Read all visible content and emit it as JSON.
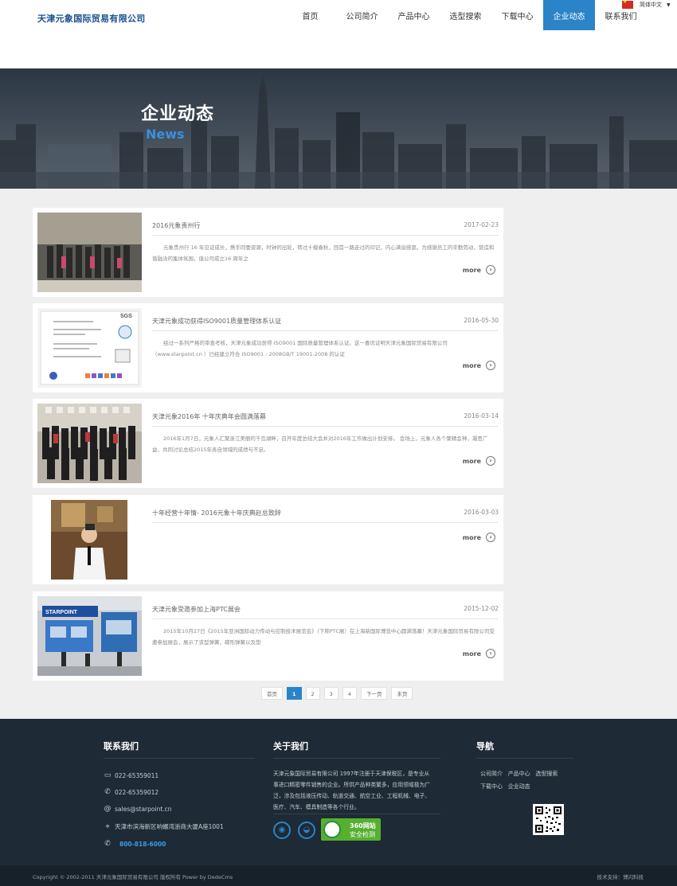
{
  "header": {
    "logo": "天津元象国际贸易有限公司",
    "nav": [
      "首页",
      "公司简介",
      "产品中心",
      "选型搜索",
      "下载中心",
      "企业动态",
      "联系我们"
    ],
    "active_index": 5,
    "language": "简体中文"
  },
  "banner": {
    "title": "企业动态",
    "subtitle": "News"
  },
  "news": [
    {
      "title": "2016元象贵州行",
      "date": "2017-02-23",
      "text": "元象贵州行 16 年见证成长，携手同壹资源，时钟的出轮，转过十载春秋，回首一路走过的印记，内心满溢感恩。为感谢员工的辛勤劳动，营造和谐融洽的集体氛围，值公司成立16 周年之",
      "more": "more"
    },
    {
      "title": "天津元象成功获得ISO9001质量管理体系认证",
      "date": "2016-05-30",
      "text": "经过一系列严格的审查考核，天津元象成功获得 ISO9001 国际质量管理体系认证。这一喜讯证明天津元象国际贸易有限公司（www.starpoint.cn ）已经建立符合 ISO9001 : 2008GB/T 19001-2008 的认证",
      "more": "more"
    },
    {
      "title": "天津元象2016年 十年庆典年会圆满落幕",
      "date": "2016-03-14",
      "text": "2016年1月7日，元象人汇聚浙江美丽的千岛湖畔，召开年度总结大会并对2016年工作做出计划安排。 会场上，元象人各个聚精会神，凝思广益，共同讨论总结2015年各自领域的成绩与不足。",
      "more": "more"
    },
    {
      "title": "十年经营十年情- 2016元象十年庆典赵总致辞",
      "date": "2016-03-03",
      "text": "",
      "more": "more"
    },
    {
      "title": "天津元象受邀参加上海PTC展会",
      "date": "2015-12-02",
      "text": "2015年10月27日《2015年亚洲国际动力传动与控制技术展览会》（下称PTC展）在上海新国际博览中心圆满落幕！天津元象国际贸易有限公司受邀参加展会，展示了该型弹簧，碟形弹簧以及垫",
      "more": "more"
    }
  ],
  "pager": [
    "首页",
    "1",
    "2",
    "3",
    "4",
    "下一页",
    "末页"
  ],
  "pager_current": "1",
  "footer": {
    "contact_title": "联系我们",
    "fax": "022-65359011",
    "phone": "022-65359012",
    "email": "sales@starpoint.cn",
    "address": "天津市滨海新区响螺湾浙商大厦A座1001",
    "hotline": "800-818-6000",
    "about_title": "关于我们",
    "about_text": "天津元象国际贸易有限公司 1997年注册于天津保税区，是专业从事进口精密零件销售的企业。所供产品种类繁多，应用领域极为广泛，涉及包括液压传动、轨道交通、航空工业、工程机械、电子、医疗、汽车、模具制造等各个行业。",
    "badge_line1": "360网站",
    "badge_line2": "安全检测",
    "nav_title": "导航",
    "nav_links": [
      "公司简介",
      "产品中心",
      "选型搜索",
      "下载中心",
      "企业动态"
    ],
    "copyright": "Copyright © 2002-2011 天津元象国际贸易有限公司 版权所有 Power by DedeCms",
    "support": "技术支持：博闪科技"
  },
  "colors": {
    "brand": "#1a4f8f",
    "accent": "#2a84c7",
    "footer_bg": "#1e2a35",
    "page_bg": "#efefef"
  }
}
